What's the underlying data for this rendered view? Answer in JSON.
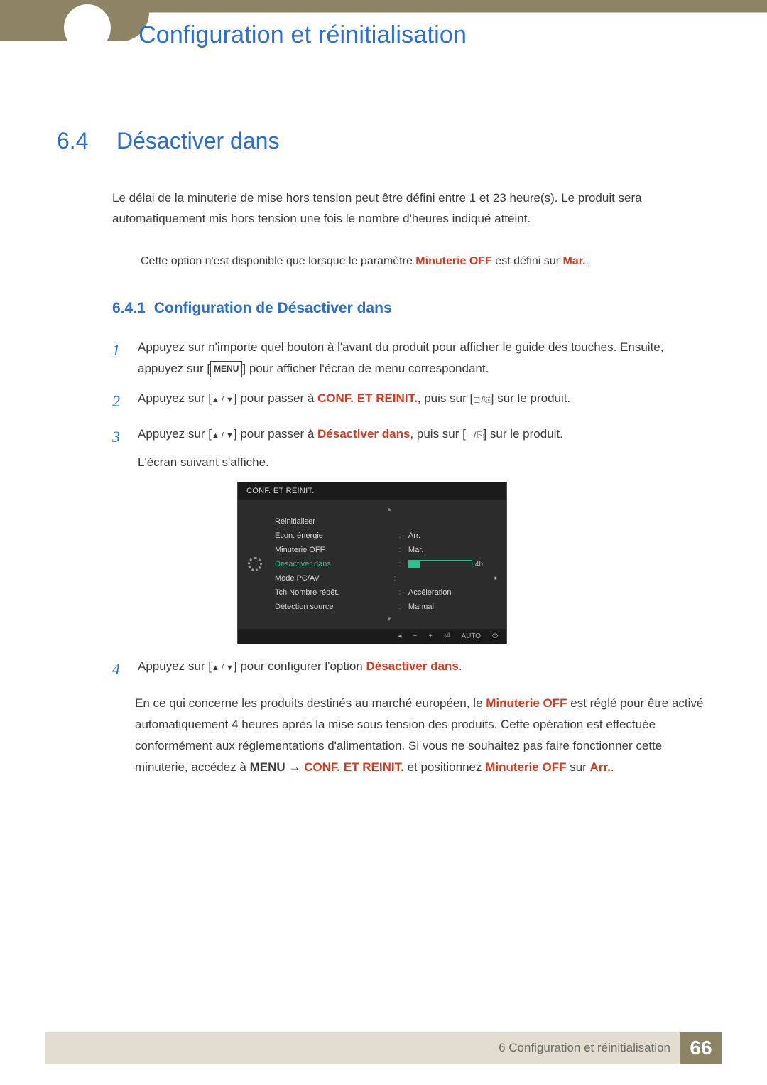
{
  "header": {
    "chapter_title": "Configuration et réinitialisation"
  },
  "section": {
    "number": "6.4",
    "title": "Désactiver dans",
    "intro": "Le délai de la minuterie de mise hors tension peut être défini entre 1 et 23 heure(s). Le produit sera automatiquement mis hors tension une fois le nombre d'heures indiqué atteint.",
    "note_pre": "Cette option n'est disponible que lorsque le paramètre ",
    "note_hl1": "Minuterie OFF",
    "note_mid": " est défini sur ",
    "note_hl2": "Mar.",
    "note_post": "."
  },
  "subsection": {
    "number": "6.4.1",
    "title": "Configuration de Désactiver dans"
  },
  "steps": {
    "s1": {
      "n": "1",
      "a": "Appuyez sur n'importe quel bouton à l'avant du produit pour afficher le guide des touches. Ensuite, appuyez sur [",
      "menu": "MENU",
      "b": "] pour afficher l'écran de menu correspondant."
    },
    "s2": {
      "n": "2",
      "a": "Appuyez sur [",
      "b": "] pour passer à ",
      "hl": "CONF. ET REINIT.",
      "c": ", puis sur [",
      "d": "] sur le produit."
    },
    "s3": {
      "n": "3",
      "a": "Appuyez sur [",
      "b": "] pour passer à ",
      "hl": "Désactiver dans",
      "c": ", puis sur [",
      "d": "] sur le produit.",
      "e": "L'écran suivant s'affiche."
    },
    "s4": {
      "n": "4",
      "a": "Appuyez sur [",
      "b": "] pour configurer l'option ",
      "hl": "Désactiver dans",
      "c": "."
    }
  },
  "osd": {
    "title": "CONF. ET REINIT.",
    "rows": [
      {
        "label": "Réinitialiser",
        "value": ""
      },
      {
        "label": "Econ. énergie",
        "value": "Arr."
      },
      {
        "label": "Minuterie OFF",
        "value": "Mar."
      },
      {
        "label": "Désactiver dans",
        "value": "4h",
        "selected": true
      },
      {
        "label": "Mode PC/AV",
        "value": "",
        "caret": true
      },
      {
        "label": "Tch Nombre répét.",
        "value": "Accélération"
      },
      {
        "label": "Détection source",
        "value": "Manual"
      }
    ],
    "footer": [
      "◂",
      "−",
      "+",
      "⏎",
      "AUTO",
      "⏻"
    ]
  },
  "footnote": {
    "a": "En ce qui concerne les produits destinés au marché européen, le ",
    "hl1": "Minuterie OFF",
    "b": " est réglé pour être activé automatiquement 4 heures après la mise sous tension des produits. Cette opération est effectuée conformément aux réglementations d'alimentation. Si vous ne souhaitez pas faire fonctionner cette minuterie, accédez à ",
    "menu": "MENU",
    "arrow": " → ",
    "hl2": "CONF. ET REINIT.",
    "c": " et positionnez ",
    "hl3": "Minuterie OFF",
    "d": " sur ",
    "hl4": "Arr.",
    "e": "."
  },
  "footer": {
    "label": "6 Configuration et réinitialisation",
    "page": "66"
  }
}
